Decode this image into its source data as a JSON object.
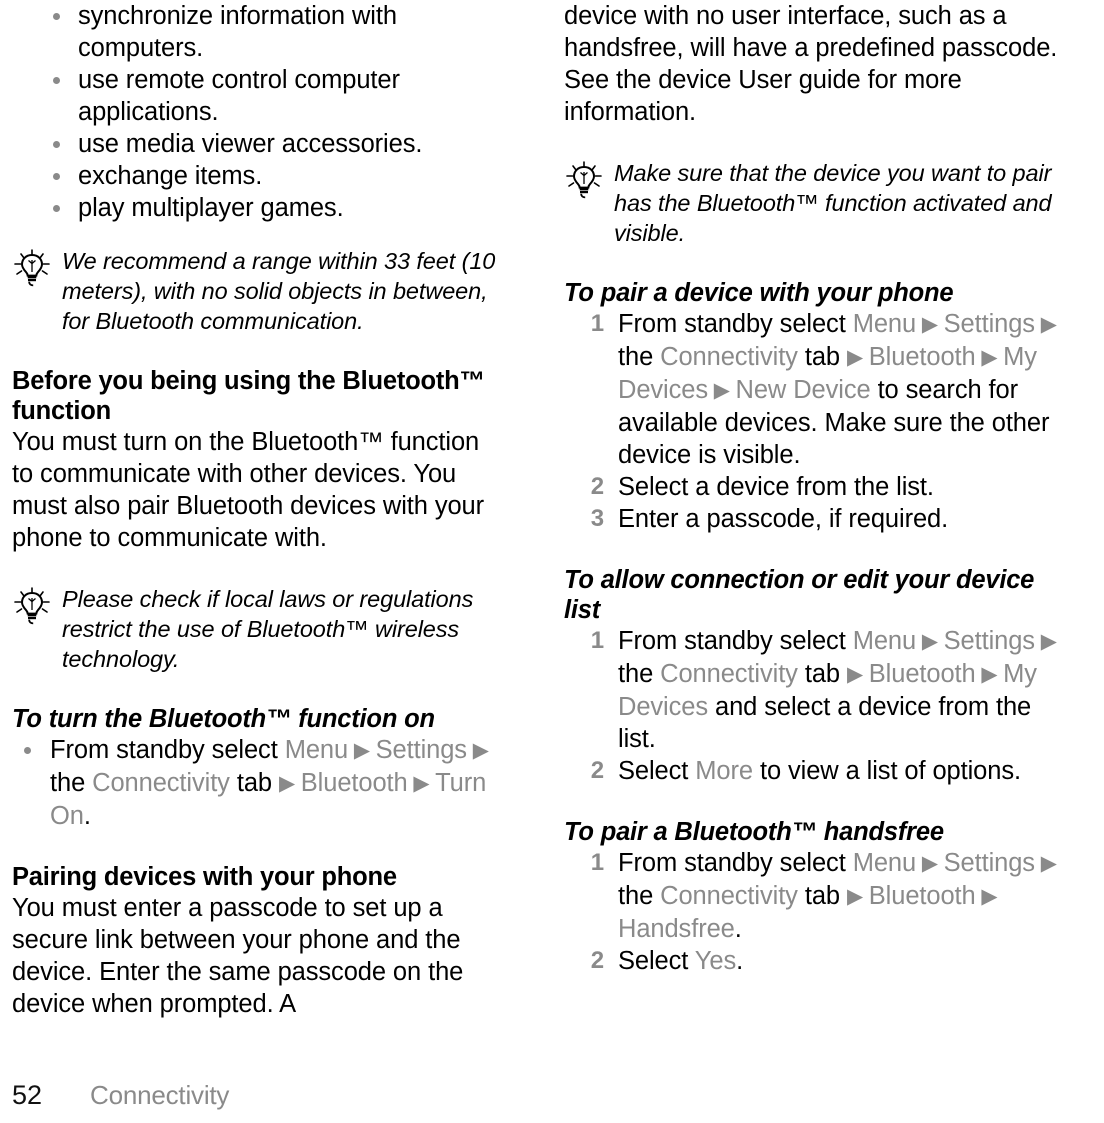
{
  "page": {
    "number": "52",
    "chapter": "Connectivity",
    "icon_names": {
      "tip": "lightbulb-tip-icon",
      "bullet": "bullet-dot-icon",
      "arrow": "right-triangle-arrow-icon"
    },
    "colors": {
      "text": "#000000",
      "ui_term_gray": "#8a8a8a",
      "background": "#ffffff"
    }
  },
  "left_column": {
    "intro_bullets": [
      "synchronize information with computers.",
      "use remote control computer applications.",
      "use media viewer accessories.",
      "exchange items.",
      "play multiplayer games."
    ],
    "tip_range": "We recommend a range within 33 feet (10 meters), with no solid objects in between, for Bluetooth communication.",
    "heading_before": "Before you being using the Bluetooth™ function",
    "paragraph_before": "You must turn on the Bluetooth™ function to communicate with other devices. You must also pair Bluetooth devices with your phone to communicate with.",
    "tip_laws": "Please check if local laws or regulations restrict the use of Bluetooth™ wireless technology.",
    "heading_turn_on": "To turn the Bluetooth™ function on",
    "turn_on_step": {
      "pre": "From standby select ",
      "t1": "Menu",
      "t2": "Settings",
      "mid": " the ",
      "t3": "Connectivity",
      "tab_word": " tab ",
      "t4": "Bluetooth",
      "t5": "Turn On",
      "post": "."
    },
    "heading_pairing": "Pairing devices with your phone",
    "paragraph_pairing": "You must enter a passcode to set up a secure link between your phone and the device. Enter the same passcode on the device when prompted. A"
  },
  "right_column": {
    "paragraph_continued": "device with no user interface, such as a handsfree, will have a predefined passcode. See the device User guide for more information.",
    "tip_pair": "Make sure that the device you want to pair has the Bluetooth™ function activated and visible.",
    "heading_pair_device": "To pair a device with your phone",
    "pair_device_steps": {
      "step1": {
        "num": "1",
        "pre": "From standby select ",
        "t1": "Menu",
        "t2": "Settings",
        "mid": " the ",
        "t3": "Connectivity",
        "tab_word": " tab ",
        "t4": "Bluetooth",
        "t5": "My Devices",
        "t6": "New Device",
        "post": " to search for available devices. Make sure the other device is visible."
      },
      "step2": {
        "num": "2",
        "text": "Select a device from the list."
      },
      "step3": {
        "num": "3",
        "text": "Enter a passcode, if required."
      }
    },
    "heading_allow_connection": "To allow connection or edit your device list",
    "allow_connection_steps": {
      "step1": {
        "num": "1",
        "pre": "From standby select ",
        "t1": "Menu",
        "t2": "Settings",
        "mid": " the ",
        "t3": "Connectivity",
        "tab_word": " tab ",
        "t4": "Bluetooth",
        "t5": "My Devices",
        "post": " and select a device from the list."
      },
      "step2": {
        "num": "2",
        "pre": "Select ",
        "t1": "More",
        "post": " to view a list of options."
      }
    },
    "heading_pair_handsfree": "To pair a Bluetooth™ handsfree",
    "pair_handsfree_steps": {
      "step1": {
        "num": "1",
        "pre": "From standby select ",
        "t1": "Menu",
        "t2": "Settings",
        "mid": " the ",
        "t3": "Connectivity",
        "tab_word": " tab ",
        "t4": "Bluetooth",
        "t5": "Handsfree",
        "post": "."
      },
      "step2": {
        "num": "2",
        "pre": "Select ",
        "t1": "Yes",
        "post": "."
      }
    }
  }
}
